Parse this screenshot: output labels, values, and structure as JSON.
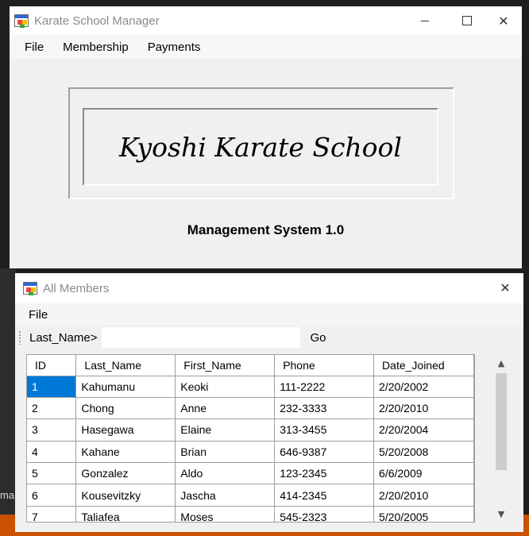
{
  "background": {
    "partial_text": "ma"
  },
  "main_window": {
    "title": "Karate School Manager",
    "menu": [
      "File",
      "Membership",
      "Payments"
    ],
    "school_name": "Kyoshi Karate School",
    "subtitle": "Management System 1.0"
  },
  "members_window": {
    "title": "All Members",
    "menu": [
      "File"
    ],
    "toolbar": {
      "label": "Last_Name>",
      "search_value": "",
      "go_label": "Go"
    },
    "columns": [
      "ID",
      "Last_Name",
      "First_Name",
      "Phone",
      "Date_Joined"
    ],
    "rows": [
      [
        "1",
        "Kahumanu",
        "Keoki",
        "111-2222",
        "2/20/2002"
      ],
      [
        "2",
        "Chong",
        "Anne",
        "232-3333",
        "2/20/2010"
      ],
      [
        "3",
        "Hasegawa",
        "Elaine",
        "313-3455",
        "2/20/2004"
      ],
      [
        "4",
        "Kahane",
        "Brian",
        "646-9387",
        "5/20/2008"
      ],
      [
        "5",
        "Gonzalez",
        "Aldo",
        "123-2345",
        "6/6/2009"
      ],
      [
        "6",
        "Kousevitzky",
        "Jascha",
        "414-2345",
        "2/20/2010"
      ],
      [
        "7",
        "Taliafea",
        "Moses",
        "545-2323",
        "5/20/2005"
      ]
    ],
    "selected_color": "#0078d7"
  },
  "icons": {
    "minimize": "minimize-icon",
    "maximize": "maximize-icon",
    "close": "close-icon",
    "app": "app-icon",
    "scroll_up": "chevron-up-icon",
    "scroll_down": "chevron-down-icon"
  }
}
